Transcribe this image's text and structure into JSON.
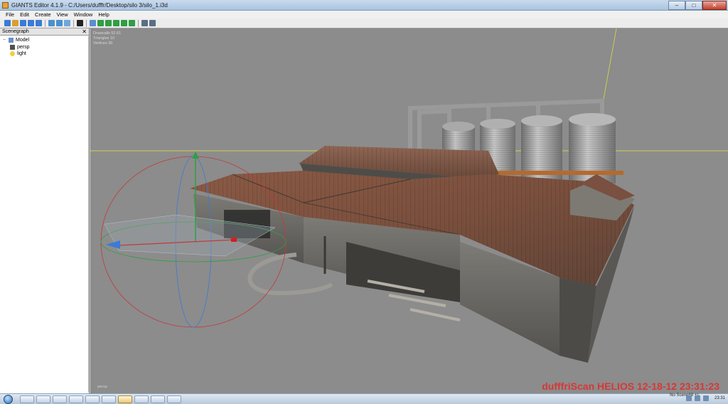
{
  "window": {
    "title": "GIANTS Editor 4.1.9 - C:/Users/dufffr/Desktop/silo 3/silo_1.i3d",
    "minimize": "–",
    "maximize": "□",
    "close": "✕"
  },
  "menu": {
    "items": [
      "File",
      "Edit",
      "Create",
      "View",
      "Window",
      "Help"
    ]
  },
  "toolbar": {
    "button_colors": [
      "#3a7bd5",
      "#d8a032",
      "#3a7bd5",
      "#3a7bd5",
      "#3a7bd5",
      "#4a90d0",
      "#4a90d0",
      "#6fa8dc",
      "#222222",
      "#5b8fd1",
      "#2f9e44",
      "#2f9e44",
      "#2f9e44",
      "#2f9e44",
      "#2f9e44",
      "#5a6f86",
      "#5a6f86"
    ]
  },
  "scenegraph": {
    "title": "Scenegraph",
    "close": "✕",
    "nodes": [
      {
        "label": "Model",
        "icon": "model-icon",
        "color": "#6a8fc9",
        "expander": "−",
        "indent": 0
      },
      {
        "label": "persp",
        "icon": "camera-icon",
        "color": "#505050",
        "expander": "",
        "indent": 1
      },
      {
        "label": "light",
        "icon": "light-bulb-icon",
        "color": "#f0d040",
        "expander": "",
        "indent": 1
      }
    ]
  },
  "viewport": {
    "stats": [
      "Drawcalls 52.61",
      "Triangles 10",
      "Vertices 30"
    ],
    "camera": "persp",
    "watermark": "dufffriScan HELIOS 12-18-12 23:31:23",
    "background": "#8c8c8c"
  },
  "taskbar": {
    "status": "No Scene68 +/-",
    "clock": "23:31"
  }
}
